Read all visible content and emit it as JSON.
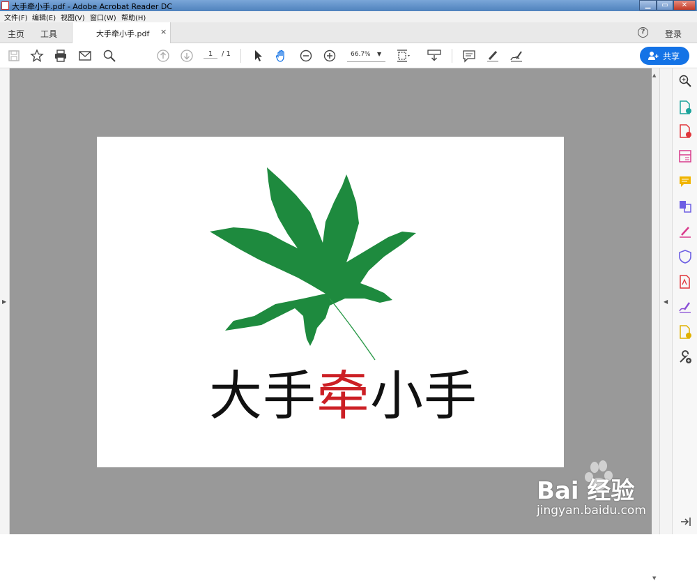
{
  "window": {
    "title": "大手牵小手.pdf - Adobe Acrobat Reader DC"
  },
  "menu": [
    "文件(F)",
    "编辑(E)",
    "视图(V)",
    "窗口(W)",
    "帮助(H)"
  ],
  "tabs": {
    "home": "主页",
    "tools": "工具",
    "document": "大手牵小手.pdf",
    "close": "×"
  },
  "header": {
    "help": "?",
    "login": "登录"
  },
  "toolbar": {
    "page_current": "1",
    "page_total": "/ 1",
    "zoom": "66.7%",
    "share_label": "共享"
  },
  "document": {
    "logo_text_part1": "大手",
    "logo_text_red": "牵",
    "logo_text_part2": "小手",
    "leaf_color": "#1e8a3e",
    "accent_color": "#cc1f24"
  },
  "watermark": {
    "brand": "Bai 经验",
    "url": "jingyan.baidu.com"
  },
  "colors": {
    "share_button": "#1473e6",
    "document_background": "#999999"
  }
}
